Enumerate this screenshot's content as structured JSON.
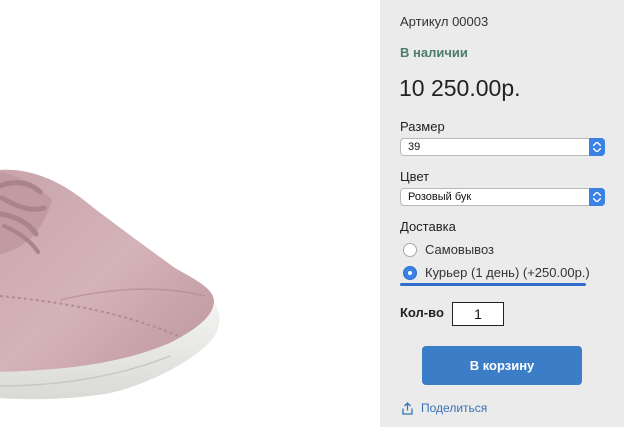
{
  "product": {
    "sku": "Артикул 00003",
    "stock_status": "В наличии",
    "price": "10 250.00р."
  },
  "size": {
    "label": "Размер",
    "selected": "39"
  },
  "color": {
    "label": "Цвет",
    "selected": "Розовый бук"
  },
  "delivery": {
    "label": "Доставка",
    "options": [
      {
        "label": "Самовывоз",
        "selected": false
      },
      {
        "label": "Курьер (1 день) (+250.00р.)",
        "selected": true
      }
    ]
  },
  "quantity": {
    "label": "Кол-во",
    "value": "1"
  },
  "actions": {
    "cart_button": "В корзину",
    "share_link": "Поделиться"
  },
  "colors": {
    "panel_bg": "#ebebeb",
    "accent": "#3b7dc6",
    "stock_green": "#4f7a6f"
  }
}
